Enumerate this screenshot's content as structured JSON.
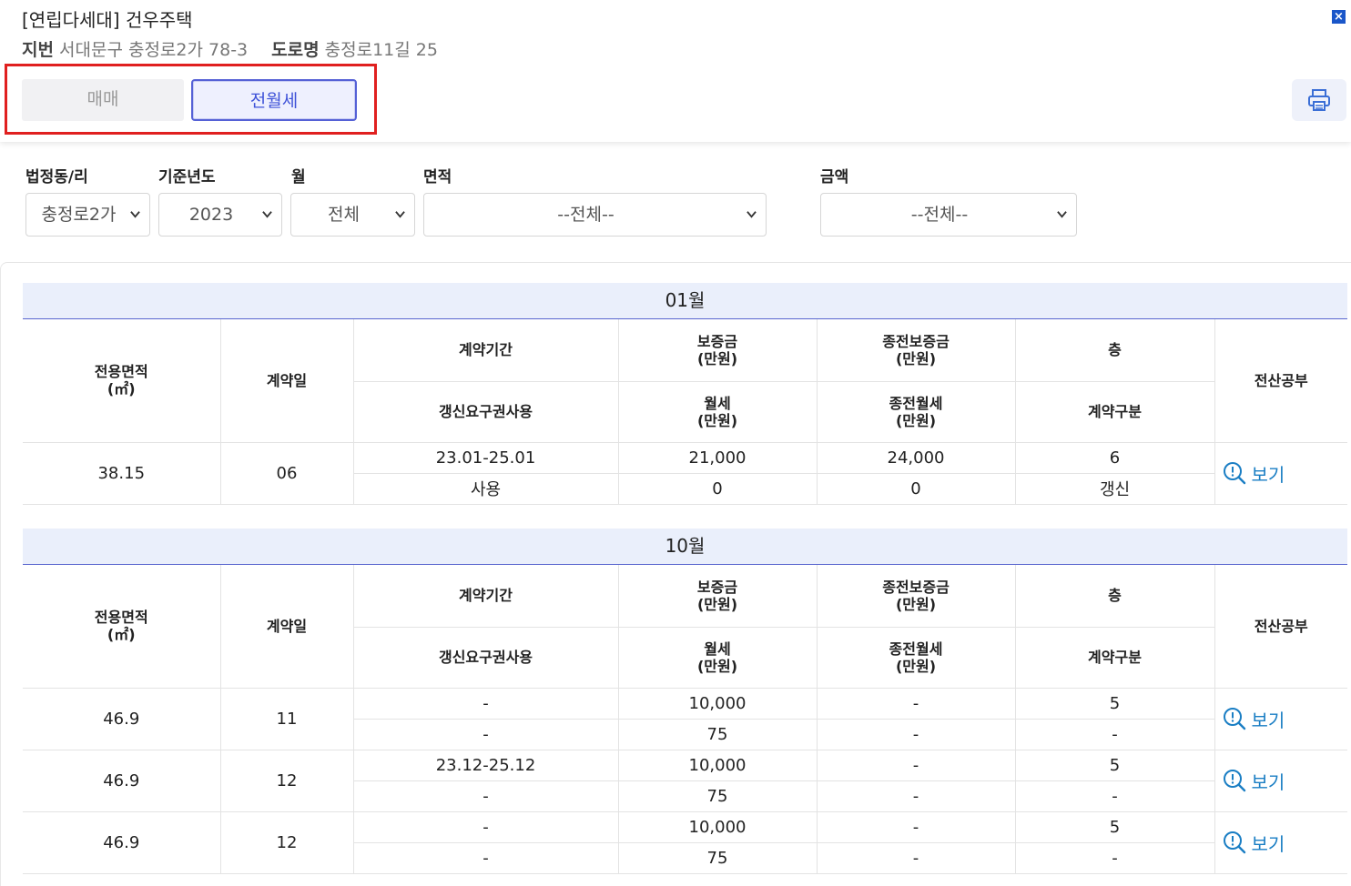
{
  "header": {
    "title": "[연립다세대] 건우주택",
    "jibun_label": "지번",
    "jibun_value": "서대문구 충정로2가 78-3",
    "road_label": "도로명",
    "road_value": "충정로11길 25",
    "close_label": "×",
    "tabs": {
      "sale": "매매",
      "rent": "전월세"
    },
    "print_icon": "printer-icon"
  },
  "filters": {
    "dong_label": "법정동/리",
    "dong_value": "충정로2가",
    "year_label": "기준년도",
    "year_value": "2023",
    "month_label": "월",
    "month_value": "전체",
    "area_label": "면적",
    "area_value": "--전체--",
    "amount_label": "금액",
    "amount_value": "--전체--"
  },
  "table_headers": {
    "area": "전용면적",
    "area_unit": "(㎡)",
    "contract_date": "계약일",
    "period": "계약기간",
    "renewal_right": "갱신요구권사용",
    "deposit": "보증금",
    "deposit_unit": "(만원)",
    "monthly": "월세",
    "monthly_unit": "(만원)",
    "prev_deposit": "종전보증금",
    "prev_deposit_unit": "(만원)",
    "prev_monthly": "종전월세",
    "prev_monthly_unit": "(만원)",
    "floor": "층",
    "contract_type": "계약구분",
    "registry": "전산공부",
    "view_label": "보기"
  },
  "sections": [
    {
      "month": "01월",
      "rows": [
        {
          "area": "38.15",
          "day": "06",
          "period": "23.01-25.01",
          "renewal": "사용",
          "deposit": "21,000",
          "monthly": "0",
          "prev_deposit": "24,000",
          "prev_monthly": "0",
          "floor": "6",
          "type": "갱신"
        }
      ]
    },
    {
      "month": "10월",
      "rows": [
        {
          "area": "46.9",
          "day": "11",
          "period": "-",
          "renewal": "-",
          "deposit": "10,000",
          "monthly": "75",
          "prev_deposit": "-",
          "prev_monthly": "-",
          "floor": "5",
          "type": "-"
        },
        {
          "area": "46.9",
          "day": "12",
          "period": "23.12-25.12",
          "renewal": "-",
          "deposit": "10,000",
          "monthly": "75",
          "prev_deposit": "-",
          "prev_monthly": "-",
          "floor": "5",
          "type": "-"
        },
        {
          "area": "46.9",
          "day": "12",
          "period": "-",
          "renewal": "-",
          "deposit": "10,000",
          "monthly": "75",
          "prev_deposit": "-",
          "prev_monthly": "-",
          "floor": "5",
          "type": "-"
        }
      ]
    }
  ]
}
